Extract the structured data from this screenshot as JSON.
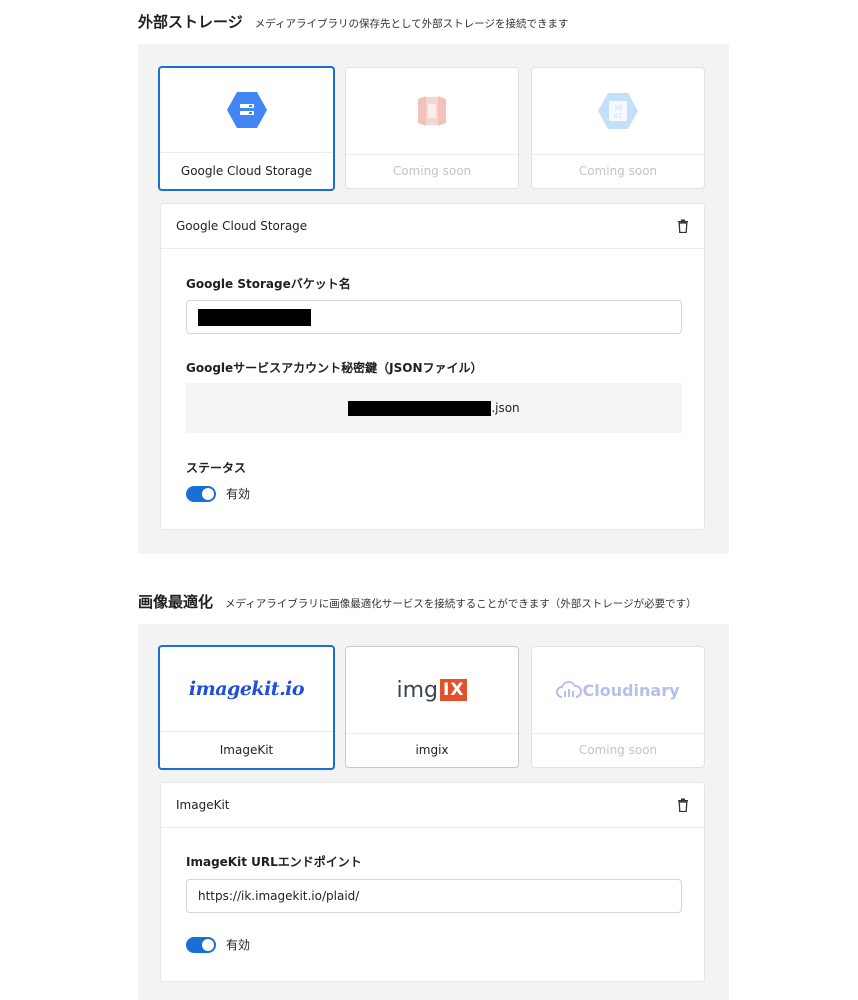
{
  "storage": {
    "title": "外部ストレージ",
    "description": "メディアライブラリの保存先として外部ストレージを接続できます",
    "cards": [
      {
        "label": "Google Cloud Storage",
        "icon": "google-cloud-storage-icon",
        "selected": true
      },
      {
        "label": "Coming soon",
        "icon": "aws-s3-icon",
        "selected": false
      },
      {
        "label": "Coming soon",
        "icon": "azure-blob-icon",
        "selected": false
      }
    ],
    "detail": {
      "header": "Google Cloud Storage",
      "bucket_label": "Google Storageバケット名",
      "key_label": "Googleサービスアカウント秘密鍵（JSONファイル）",
      "key_file_suffix": ".json",
      "status_label": "ステータス",
      "toggle_label": "有効"
    }
  },
  "optimization": {
    "title": "画像最適化",
    "description": "メディアライブラリに画像最適化サービスを接続することができます（外部ストレージが必要です）",
    "cards": [
      {
        "label": "ImageKit",
        "logo_text": "imagekit.io",
        "selected": true
      },
      {
        "label": "imgix",
        "logo_text": "img",
        "logo_badge": "IX",
        "selected": false
      },
      {
        "label": "Coming soon",
        "logo_text": "Cloudinary",
        "selected": false
      }
    ],
    "detail": {
      "header": "ImageKit",
      "endpoint_label": "ImageKit URLエンドポイント",
      "endpoint_value": "https://ik.imagekit.io/plaid/",
      "toggle_label": "有効"
    }
  },
  "colors": {
    "accent": "#1a6fd6",
    "gcs": "#4285f4",
    "s3": "#e25444",
    "azure": "#59a9f0",
    "imgix": "#e0522a",
    "cloudinary": "#3448c5"
  }
}
